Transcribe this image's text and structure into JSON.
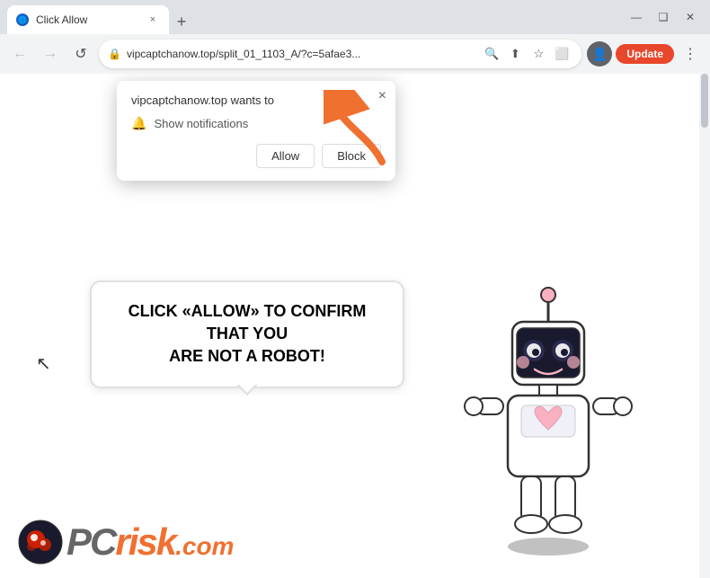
{
  "browser": {
    "title": "Click Allow",
    "tab": {
      "favicon": "🌐",
      "title": "Click Allow",
      "close": "×"
    },
    "new_tab": "+",
    "window_controls": {
      "minimize": "—",
      "maximize": "❑",
      "close": "✕"
    },
    "nav": {
      "back": "←",
      "forward": "→",
      "reload": "↺"
    },
    "url": "vipcaptchanow.top/split_01_1103_A/?c=5afae3...",
    "url_icons": {
      "search": "🔍",
      "share": "⬆",
      "bookmark": "☆",
      "extension": "⬜"
    },
    "update_label": "Update",
    "menu": "⋮"
  },
  "notification_popup": {
    "site": "vipcaptchanow.top wants to",
    "permission": "Show notifications",
    "allow": "Allow",
    "block": "Block",
    "close": "×"
  },
  "speech_bubble": {
    "line1": "CLICK «ALLOW» TO CONFIRM THAT YOU",
    "line2": "ARE NOT A ROBOT!"
  },
  "pcrisk": {
    "pc": "PC",
    "risk": "risk",
    "com": ".com"
  },
  "colors": {
    "arrow": "#f07030",
    "update_btn": "#e8472b",
    "bubble_border": "#e0e0e0"
  }
}
